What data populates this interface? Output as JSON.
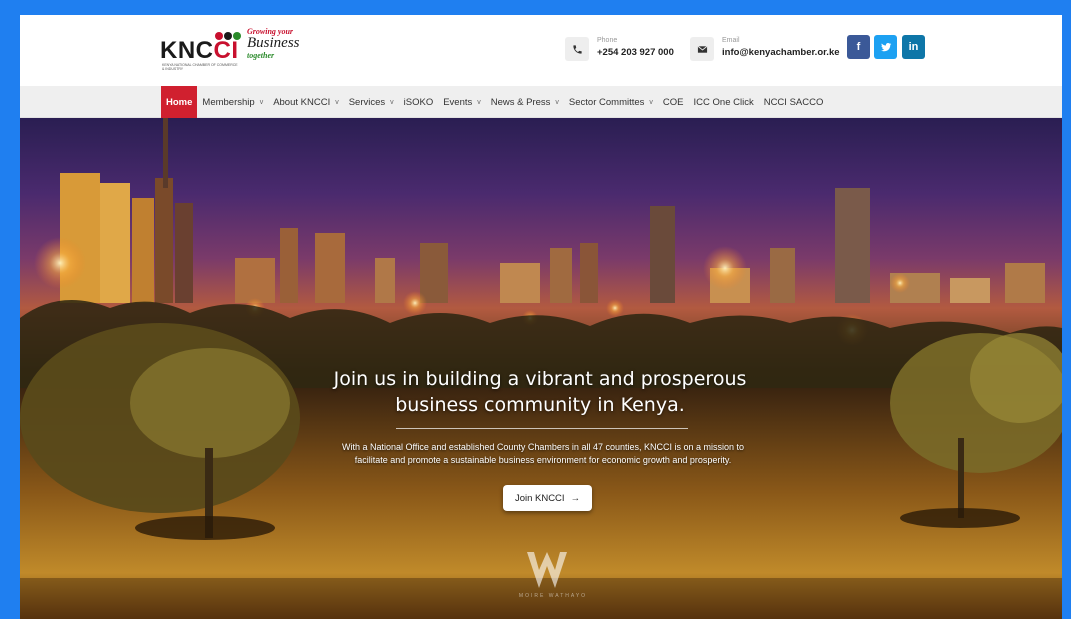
{
  "logo": {
    "brand_prefix": "KNC",
    "brand_suffix": "CI",
    "tagline_top": "Growing your",
    "tagline_mid": "Business",
    "tagline_bottom": "together",
    "subtext": "KENYA NATIONAL CHAMBER OF COMMERCE & INDUSTRY",
    "dot_colors": [
      "#c8102e",
      "#1a1a1a",
      "#2a8a2a"
    ]
  },
  "contact": {
    "phone_label": "Phone",
    "phone_value": "+254 203 927 000",
    "email_label": "Email",
    "email_value": "info@kenyachamber.or.ke"
  },
  "social": {
    "facebook": "f",
    "twitter": "t",
    "linkedin": "in"
  },
  "nav": {
    "items": [
      {
        "label": "Home",
        "dropdown": false,
        "active": true
      },
      {
        "label": "Membership",
        "dropdown": true
      },
      {
        "label": "About KNCCI",
        "dropdown": true
      },
      {
        "label": "Services",
        "dropdown": true
      },
      {
        "label": "iSOKO",
        "dropdown": false
      },
      {
        "label": "Events",
        "dropdown": true
      },
      {
        "label": "News & Press",
        "dropdown": true
      },
      {
        "label": "Sector Committes",
        "dropdown": true
      },
      {
        "label": "COE",
        "dropdown": false
      },
      {
        "label": "ICC One Click",
        "dropdown": false
      },
      {
        "label": "NCCI SACCO",
        "dropdown": false
      }
    ],
    "chevron": "v"
  },
  "hero": {
    "title_line1": "Join us in building a vibrant and prosperous",
    "title_line2": "business community in Kenya.",
    "desc_line1": "With a National Office and established County Chambers in all 47 counties, KNCCI is on a mission to",
    "desc_line2": "facilitate and promote a sustainable business environment for economic growth and prosperity.",
    "cta_label": "Join KNCCI",
    "cta_arrow": "→",
    "watermark_text": "MOIRE WATHAYO"
  },
  "colors": {
    "accent": "#d0202f",
    "frame": "#1f7ff0"
  }
}
